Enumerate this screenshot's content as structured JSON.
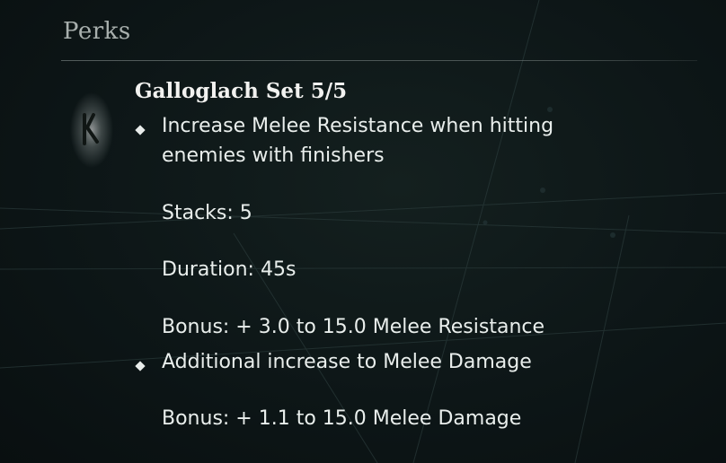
{
  "header": {
    "title": "Perks"
  },
  "perk": {
    "icon": "rune-icon",
    "title": "Galloglach Set 5/5",
    "bullets": [
      {
        "lines": [
          "Increase Melee Resistance when hitting",
          "enemies with finishers"
        ],
        "stacks": "Stacks: 5",
        "duration": "Duration: 45s",
        "bonus": "Bonus: + 3.0 to 15.0 Melee Resistance"
      },
      {
        "lines": [
          "Additional increase to Melee Damage"
        ],
        "bonus": "Bonus: + 1.1 to 15.0 Melee Damage"
      }
    ]
  },
  "colors": {
    "text": "#e9eeec",
    "header": "#a8afad",
    "background": "#0d1617"
  }
}
